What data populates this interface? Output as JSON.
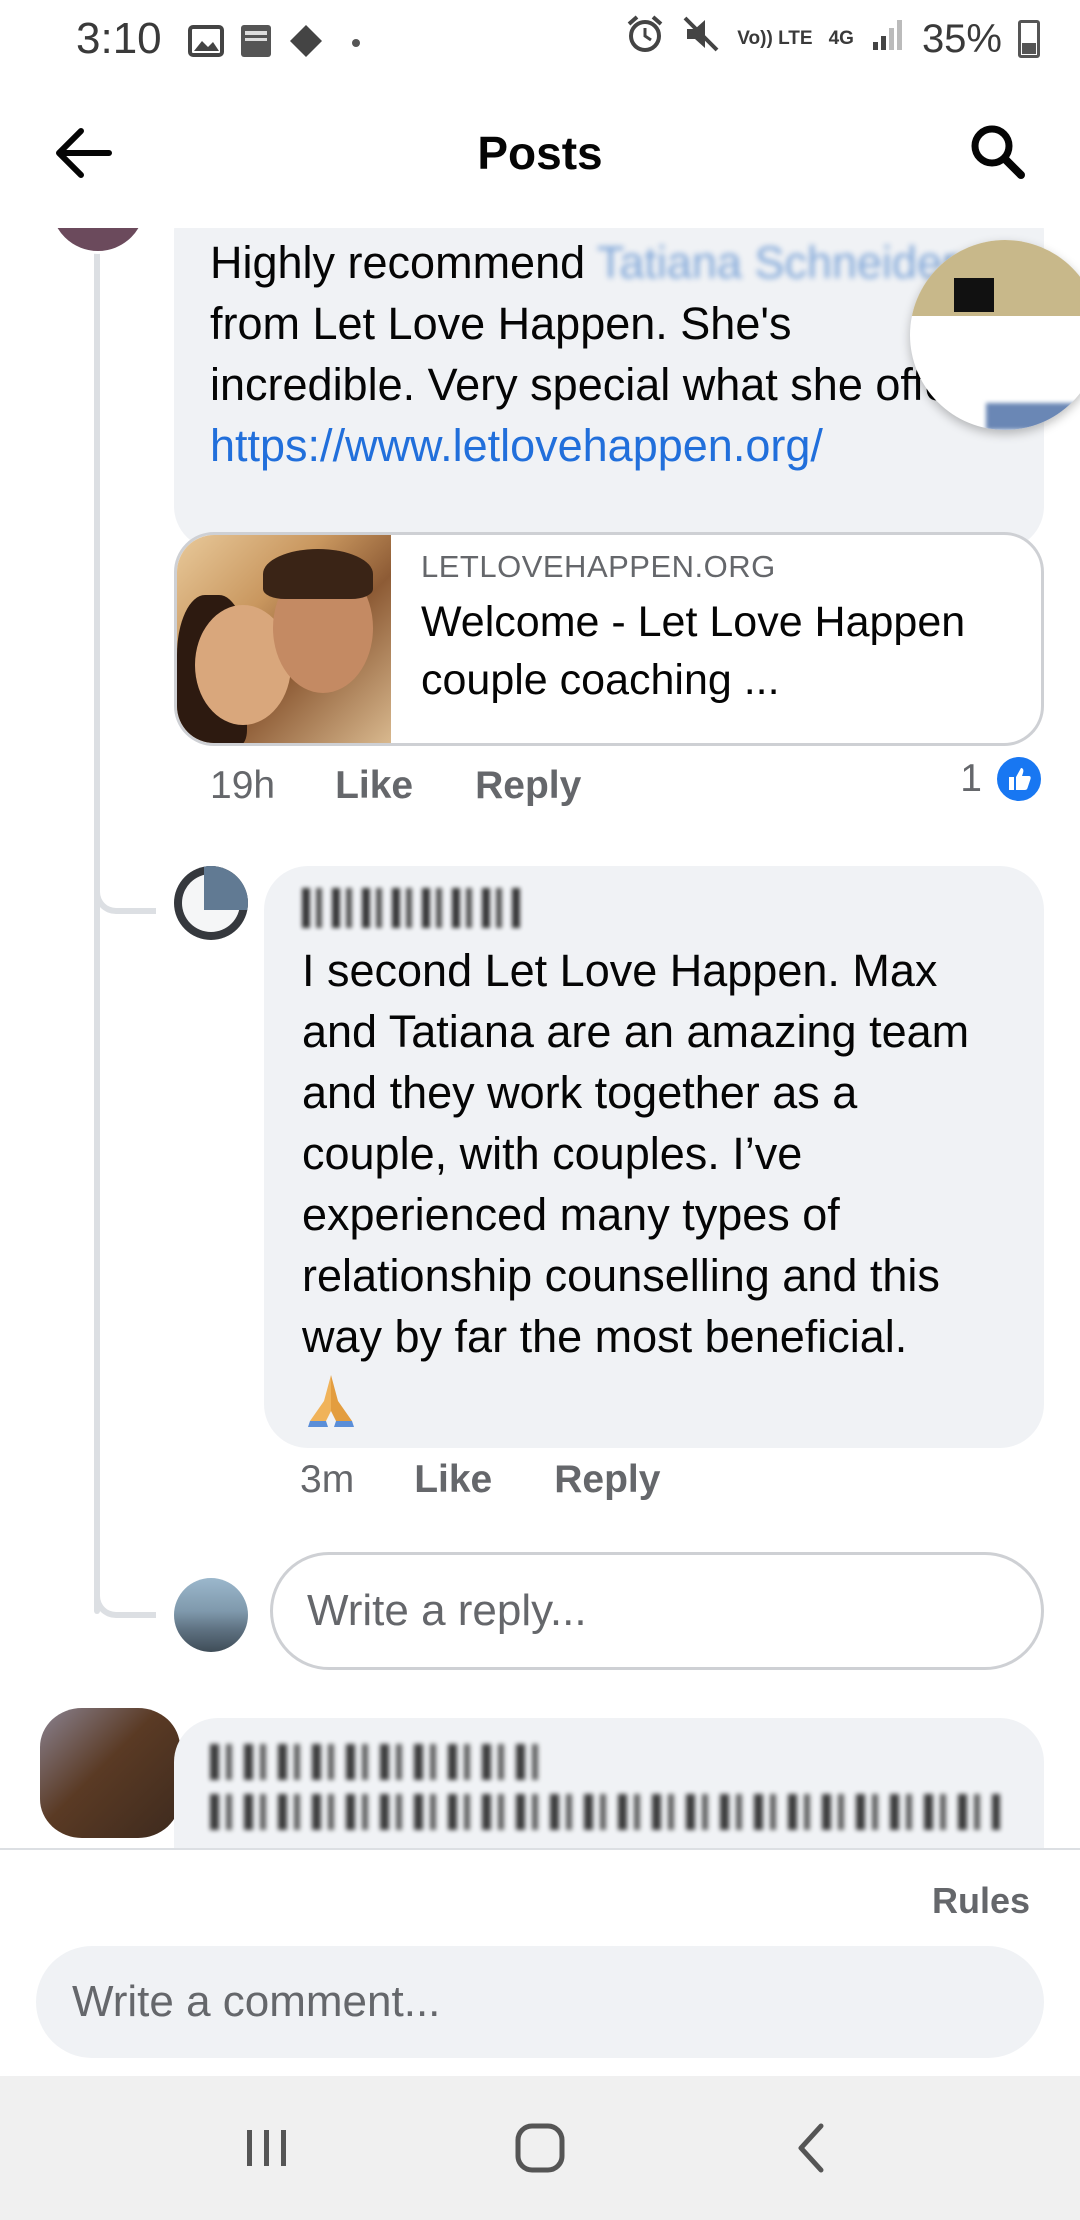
{
  "status_bar": {
    "time": "3:10",
    "left_icons": [
      "gallery-icon",
      "bible-app-icon",
      "diamond-icon",
      "dot-icon"
    ],
    "volte_label": "Vo)) LTE",
    "network_label": "4G",
    "battery": "35%"
  },
  "app_bar": {
    "title": "Posts"
  },
  "comment": {
    "text_line1": "Highly recommend",
    "blurred_name_1": "Tatiana Schneider",
    "blurred_name_2": "Schneider",
    "text_line2": " from Let Love Happen. She's incredible. Very special what she offers.",
    "link": "https://www.letlovehappen.org/",
    "preview": {
      "domain": "LETLOVEHAPPEN.ORG",
      "title": "Welcome - Let Love Happen couple coaching ..."
    },
    "time": "19h",
    "like_label": "Like",
    "reply_label": "Reply",
    "likes": "1"
  },
  "reply": {
    "text": "I second Let Love Happen. Max and Tatiana are an amazing team and they work together as a couple, with couples. I’ve experienced many types of relationship counselling and this way by far the most beneficial.",
    "time": "3m",
    "like_label": "Like",
    "reply_label": "Reply"
  },
  "reply_input": {
    "placeholder": "Write a reply..."
  },
  "composer": {
    "rules_label": "Rules",
    "placeholder": "Write a comment..."
  },
  "colors": {
    "link": "#216fdb",
    "like_blue": "#1877f2",
    "bubble_bg": "#f0f2f5",
    "muted_text": "#65676b"
  }
}
